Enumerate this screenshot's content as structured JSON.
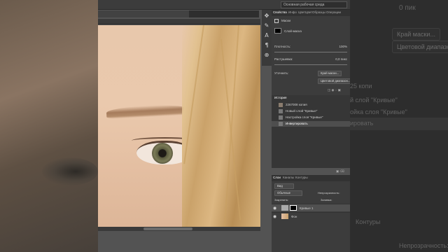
{
  "background_right": {
    "top_text": "0 пик",
    "edge_button": "Край маски...",
    "color_range_button": "Цветовой диапазо...",
    "history_copy": "25 копи",
    "new_curves_layer": "й слой \"Кривые\"",
    "curves_settings": "ойка слоя \"Кривые\"",
    "invert": "ировать",
    "contours": "Контуры",
    "opacity": "Непрозрачность:"
  },
  "workspace": {
    "name": "Основная рабочая среда"
  },
  "tools": [
    "move-icon",
    "brush-icon",
    "type-icon",
    "pen-icon",
    "eyedropper-icon"
  ],
  "properties": {
    "tabs": [
      "Свойства",
      "Инфо",
      "Цвет",
      "Цвет",
      "Образцы",
      "Операции"
    ],
    "title": "Маски",
    "layer_mask_label": "Слой-маска",
    "density_label": "Плотность:",
    "density_value": "100%",
    "feather_label": "Растушевка:",
    "feather_value": "0,0 пикс",
    "refine_label": "Уточнить:",
    "mask_edge_button": "Край маски...",
    "color_range_button": "Цветовой диапазон..."
  },
  "history": {
    "title": "История",
    "items": [
      {
        "label": "2267008 копия",
        "selected": false
      },
      {
        "label": "Новый слой \"Кривые\"",
        "selected": false
      },
      {
        "label": "Настройка слоя \"Кривые\"",
        "selected": false
      },
      {
        "label": "Инвертировать",
        "selected": true
      }
    ]
  },
  "layers": {
    "tabs": [
      "Слои",
      "Каналы",
      "Контуры"
    ],
    "filter": "Вид",
    "blend_mode": "Обычные",
    "opacity_label": "Непрозрачность:",
    "lock_label": "Закрепить:",
    "fill_label": "Заливка:",
    "items": [
      {
        "name": "Кривые 1",
        "selected": true
      },
      {
        "name": "Фон",
        "selected": false
      }
    ]
  },
  "colors": {
    "accent": "#3c3c3c",
    "panel": "#3c3c3c"
  }
}
